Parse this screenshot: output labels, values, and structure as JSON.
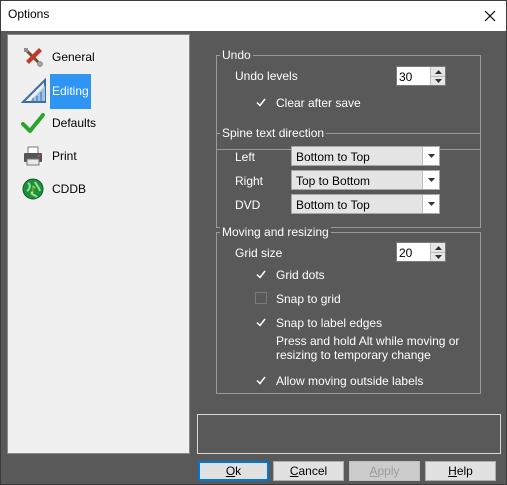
{
  "window": {
    "title": "Options"
  },
  "sidebar": {
    "items": [
      {
        "label": "General",
        "icon": "wrench-screwdriver-icon",
        "selected": false
      },
      {
        "label": "Editing",
        "icon": "ruler-triangle-icon",
        "selected": true
      },
      {
        "label": "Defaults",
        "icon": "green-checkmark-icon",
        "selected": false
      },
      {
        "label": "Print",
        "icon": "printer-icon",
        "selected": false
      },
      {
        "label": "CDDB",
        "icon": "globe-disc-icon",
        "selected": false
      }
    ]
  },
  "undo": {
    "title": "Undo",
    "levels_label": "Undo levels",
    "levels_value": "30",
    "clear_after_save_label": "Clear after save",
    "clear_after_save_checked": true
  },
  "spine": {
    "title": "Spine text direction",
    "left_label": "Left",
    "left_value": "Bottom to Top",
    "right_label": "Right",
    "right_value": "Top to Bottom",
    "dvd_label": "DVD",
    "dvd_value": "Bottom to Top"
  },
  "moving": {
    "title": "Moving and resizing",
    "grid_size_label": "Grid size",
    "grid_size_value": "20",
    "grid_dots_label": "Grid dots",
    "grid_dots_checked": true,
    "snap_to_grid_label": "Snap to grid",
    "snap_to_grid_checked": false,
    "snap_to_edges_label": "Snap to label edges",
    "snap_to_edges_checked": true,
    "hint_line1": "Press and hold Alt while moving or",
    "hint_line2": "resizing to temporary change",
    "allow_outside_label": "Allow moving outside labels",
    "allow_outside_checked": true
  },
  "buttons": {
    "ok_first": "O",
    "ok_rest": "k",
    "cancel_first": "C",
    "cancel_rest": "ancel",
    "apply_first": "A",
    "apply_rest": "pply",
    "help_first": "H",
    "help_rest": "elp"
  },
  "colors": {
    "background": "#595959",
    "selection": "#2f95f5",
    "default_button_border": "#0078d7"
  }
}
